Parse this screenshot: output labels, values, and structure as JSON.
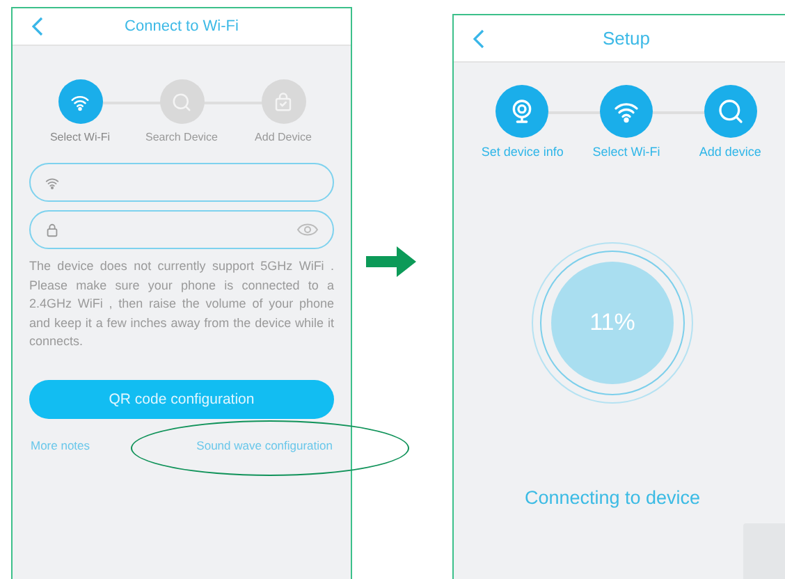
{
  "left_screen": {
    "title": "Connect to Wi-Fi",
    "steps": [
      {
        "label": "Select Wi-Fi",
        "kind": "wifi",
        "selected": true
      },
      {
        "label": "Search Device",
        "kind": "search",
        "selected": false
      },
      {
        "label": "Add Device",
        "kind": "bag",
        "selected": false
      }
    ],
    "fields": [
      {
        "kind": "wifi"
      },
      {
        "kind": "password"
      }
    ],
    "notice": "The device does not currently support 5GHz WiFi . Please make sure your phone is connected to a 2.4GHz WiFi , then raise the volume of your phone and keep it a few inches away from the device while it connects.",
    "primary_button": "QR code configuration",
    "links": [
      {
        "label": "More notes",
        "highlighted": false
      },
      {
        "label": "Sound wave configuration",
        "highlighted": true
      }
    ]
  },
  "right_screen": {
    "title": "Setup",
    "steps": [
      {
        "label": "Set device info",
        "kind": "camera",
        "selected": true
      },
      {
        "label": "Select Wi-Fi",
        "kind": "wifi",
        "selected": true
      },
      {
        "label": "Add device",
        "kind": "search",
        "selected": true
      }
    ],
    "progress": "11%",
    "status": "Connecting to device"
  }
}
